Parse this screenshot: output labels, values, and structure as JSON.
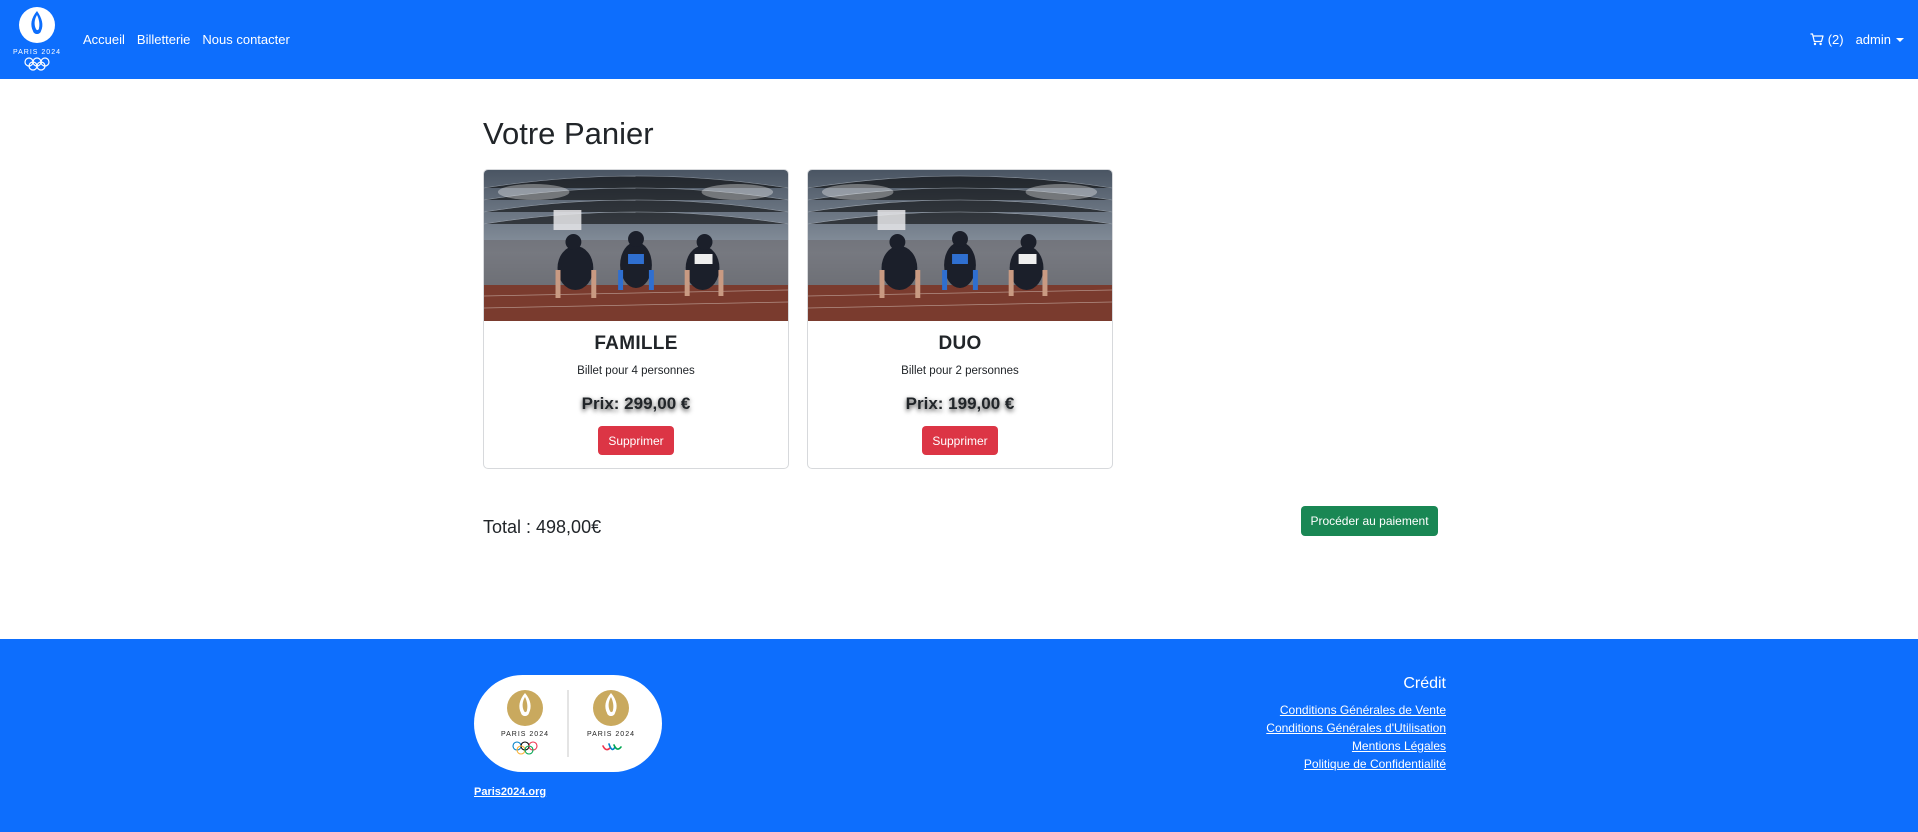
{
  "navbar": {
    "brand_text": "PARIS 2024",
    "links": [
      "Accueil",
      "Billetterie",
      "Nous contacter"
    ],
    "cart_count": "(2)",
    "user_label": "admin"
  },
  "main": {
    "title": "Votre Panier",
    "cards": [
      {
        "title": "FAMILLE",
        "text": "Billet pour 4 personnes",
        "price": "Prix: 299,00 €",
        "button": "Supprimer"
      },
      {
        "title": "DUO",
        "text": "Billet pour 2 personnes",
        "price": "Prix: 199,00 €",
        "button": "Supprimer"
      }
    ],
    "total": "Total : 498,00€",
    "pay_button": "Procéder au paiement"
  },
  "footer": {
    "logo_text_olympic": "PARIS 2024",
    "logo_text_paralympic": "PARIS 2024",
    "site_link": "Paris2024.org",
    "credit_title": "Crédit",
    "legal_links": [
      "Conditions Générales de Vente",
      "Conditions Générales d'Utilisation",
      "Mentions Légales",
      "Politique de Confidentialité"
    ]
  },
  "colors": {
    "primary": "#0d6efd",
    "danger": "#dc3545",
    "success": "#198754",
    "gold": "#c9a95e"
  },
  "icons": [
    "paris-2024-logo-icon",
    "cart-icon",
    "caret-down-icon",
    "stadium-photo"
  ]
}
